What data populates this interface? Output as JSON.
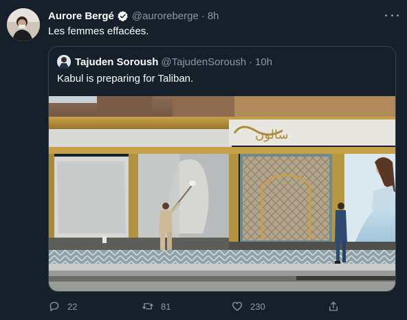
{
  "tweet": {
    "author_name": "Aurore Bergé",
    "author_handle": "@auroreberge",
    "separator": "·",
    "time": "8h",
    "text": "Les femmes effacées."
  },
  "quoted_tweet": {
    "author_name": "Tajuden Soroush",
    "author_handle": "@TajudenSoroush",
    "separator": "·",
    "time": "10h",
    "text": "Kabul is preparing for Taliban.",
    "photo_sign_text": "سالون"
  },
  "actions": {
    "reply_count": "22",
    "retweet_count": "81",
    "like_count": "230"
  },
  "colors": {
    "background": "#15202b",
    "secondary_text": "#8b98a5",
    "border": "#38444d",
    "verified_badge": "#ffffff"
  }
}
